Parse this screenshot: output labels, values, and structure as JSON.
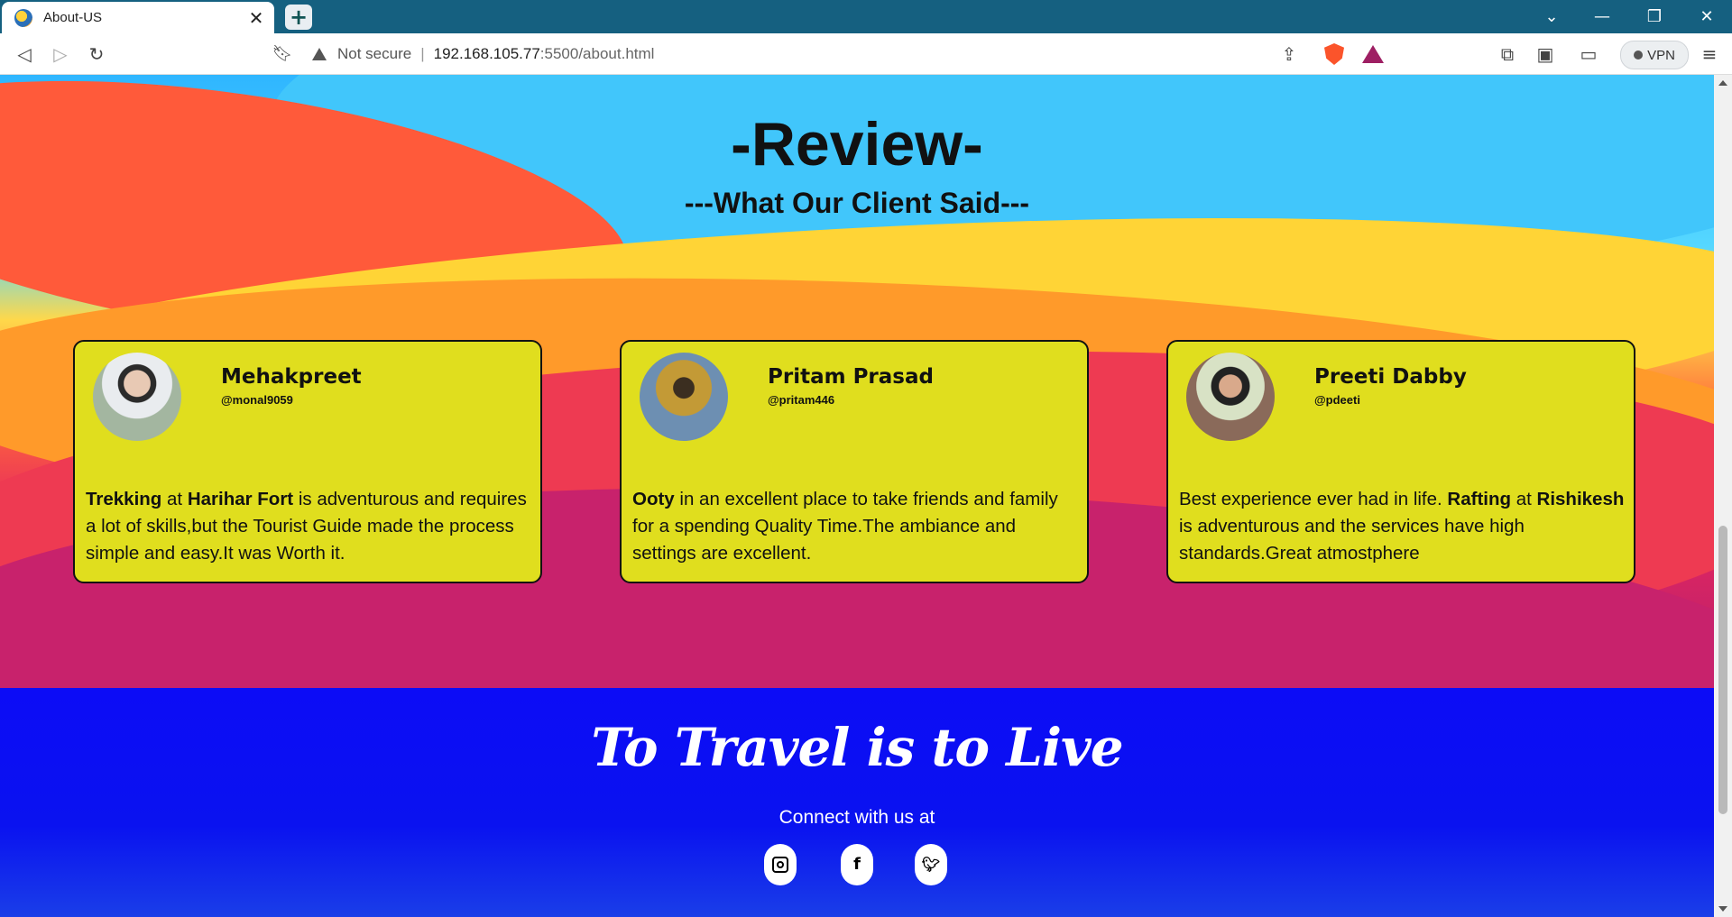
{
  "browser": {
    "tab_title": "About-US",
    "tab_close": "✕",
    "new_tab": "+",
    "not_secure": "Not secure",
    "url_host": "192.168.105.77",
    "url_path": ":5500/about.html",
    "vpn_label": "VPN",
    "controls": {
      "minimize": "—",
      "restore": "❐",
      "close": "✕",
      "tabs_menu": "⌄"
    },
    "icons": [
      "back-icon",
      "forward-icon",
      "reload-icon",
      "bookmark-icon",
      "share-icon",
      "brave-shield-icon",
      "bat-rewards-icon",
      "extensions-icon",
      "sidebar-icon",
      "wallet-icon",
      "menu-icon"
    ]
  },
  "review": {
    "title": "-Review-",
    "subtitle": "---What Our Client Said---",
    "cards": [
      {
        "name": "Mehakpreet",
        "handle": "@monal9059",
        "parts": [
          {
            "b": "Trekking"
          },
          {
            "t": " at "
          },
          {
            "b": "Harihar Fort"
          },
          {
            "t": " is adventurous and requires a lot of skills,but the Tourist Guide made the process simple and easy.It was Worth it."
          }
        ]
      },
      {
        "name": "Pritam Prasad",
        "handle": "@pritam446",
        "parts": [
          {
            "b": "Ooty"
          },
          {
            "t": " in an excellent place to take friends and family for a spending Quality Time.The ambiance and settings are excellent."
          }
        ]
      },
      {
        "name": "Preeti Dabby",
        "handle": "@pdeeti",
        "parts": [
          {
            "t": "Best experience ever had in life. "
          },
          {
            "b": "Rafting"
          },
          {
            "t": " at "
          },
          {
            "b": "Rishikesh"
          },
          {
            "t": " is adventurous and the services have high standards.Great atmostphere"
          }
        ]
      }
    ]
  },
  "footer": {
    "tagline": "To Travel is to Live",
    "connect": "Connect with us at",
    "social": [
      {
        "name": "instagram-icon",
        "glyph": ""
      },
      {
        "name": "facebook-icon",
        "glyph": "f"
      },
      {
        "name": "twitter-icon",
        "glyph": "🐦"
      }
    ]
  },
  "colors": {
    "card_bg": "#e0de1e",
    "footer_bg": "#0c0cf6",
    "tab_bar": "#156080"
  }
}
